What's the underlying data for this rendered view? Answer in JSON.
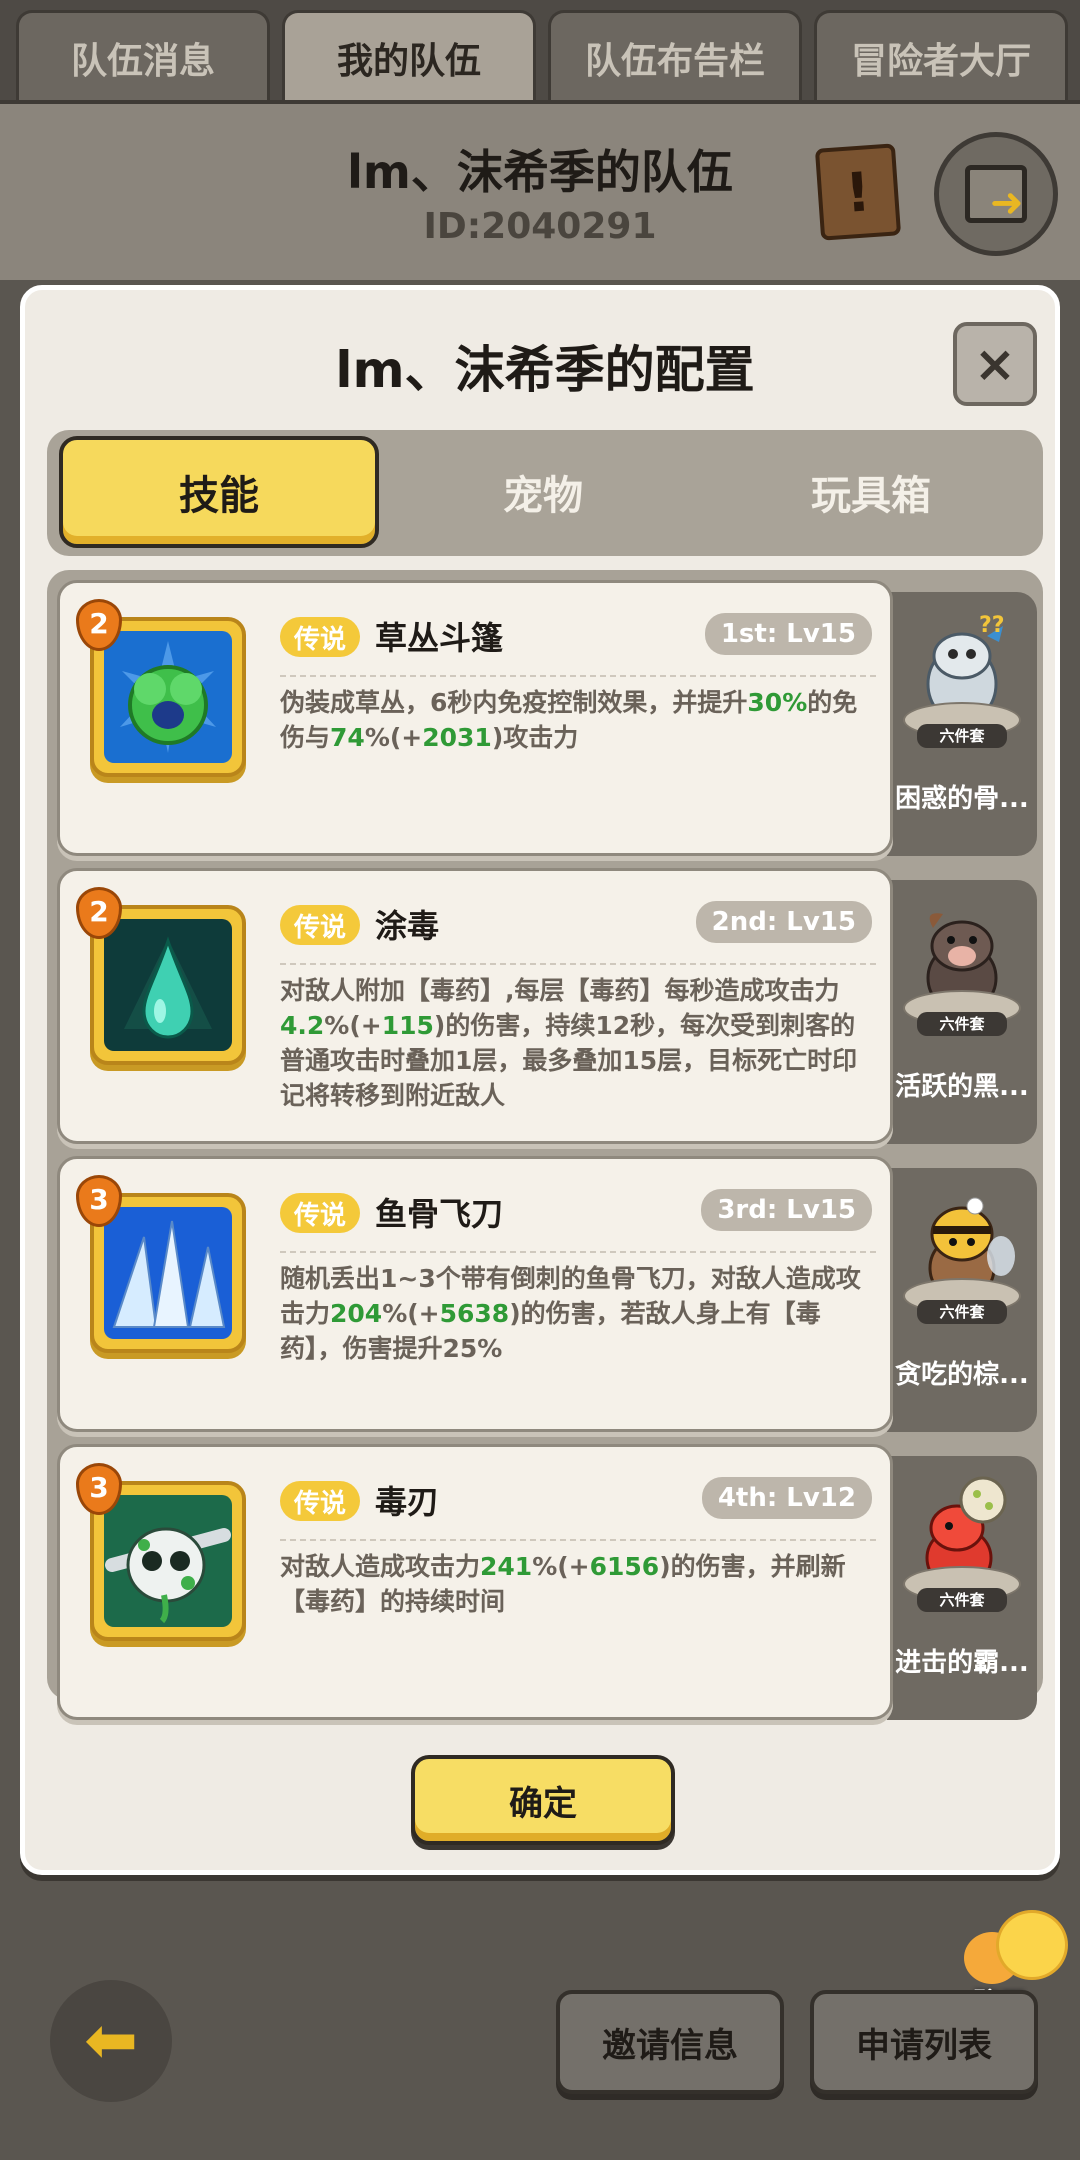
{
  "top_tabs": [
    "队伍消息",
    "我的队伍",
    "队伍布告栏",
    "冒险者大厅"
  ],
  "header": {
    "team_name": "lm、沫希季的队伍",
    "team_id": "ID:2040291"
  },
  "modal": {
    "title": "lm、沫希季的配置",
    "close_symbol": "×",
    "segments": [
      "技能",
      "宠物",
      "玩具箱"
    ],
    "confirm_label": "确定"
  },
  "skills": [
    {
      "badge": "2",
      "tag": "传说",
      "name": "草丛斗篷",
      "slot": "1st: Lv15",
      "desc_parts": [
        "伪装成草丛，6秒内免疫控制效果，并提升",
        "30%",
        "的免伤与",
        "74",
        "%(+",
        "2031",
        ")攻击力"
      ],
      "pet_name": "困惑的骨...",
      "pet_set": "六件套"
    },
    {
      "badge": "2",
      "tag": "传说",
      "name": "涂毒",
      "slot": "2nd: Lv15",
      "desc_parts": [
        "对敌人附加【毒药】,每层【毒药】每秒造成攻击力",
        "4.2",
        "%(+",
        "115",
        ")的伤害，持续12秒，每次受到刺客的普通攻击时叠加1层，最多叠加15层，目标死亡时印记将转移到附近敌人"
      ],
      "pet_name": "活跃的黑...",
      "pet_set": "六件套"
    },
    {
      "badge": "3",
      "tag": "传说",
      "name": "鱼骨飞刀",
      "slot": "3rd: Lv15",
      "desc_parts": [
        "随机丢出1~3个带有倒刺的鱼骨飞刀，对敌人造成攻击力",
        "204",
        "%(+",
        "5638",
        ")的伤害，若敌人身上有【毒药】，伤害提升25%"
      ],
      "pet_name": "贪吃的棕...",
      "pet_set": "六件套"
    },
    {
      "badge": "3",
      "tag": "传说",
      "name": "毒刃",
      "slot": "4th: Lv12",
      "desc_parts": [
        "对敌人造成攻击力",
        "241",
        "%(+",
        "6156",
        ")的伤害，并刷新【毒药】的持续时间"
      ],
      "pet_name": "进击的霸...",
      "pet_set": "六件套"
    }
  ],
  "bottom": {
    "chat_label": "聊天",
    "invite_label": "邀请信息",
    "apply_label": "申请列表"
  },
  "colors": {
    "accent_yellow": "#f6d95c",
    "legend_tag": "#f4c93a",
    "highlight_green": "#2f9a36",
    "badge_orange": "#ea7a1b"
  },
  "icons": [
    "notice-scroll-icon",
    "exit-icon",
    "close-icon",
    "back-arrow-icon",
    "chat-bubble-icon",
    "skill-bush-icon",
    "skill-poison-drop-icon",
    "skill-fishbone-icon",
    "skill-poison-skull-icon"
  ]
}
